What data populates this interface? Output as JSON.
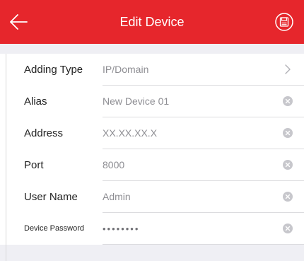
{
  "header": {
    "title": "Edit Device",
    "back_icon": "arrow-left-icon",
    "save_icon": "save-icon"
  },
  "form": {
    "rows": [
      {
        "label": "Adding Type",
        "value": "IP/Domain",
        "action_icon": "chevron-right-icon"
      },
      {
        "label": "Alias",
        "value": "New Device 01",
        "action_icon": "clear-icon"
      },
      {
        "label": "Address",
        "value": "XX.XX.XX.X",
        "action_icon": "clear-icon"
      },
      {
        "label": "Port",
        "value": "8000",
        "action_icon": "clear-icon"
      },
      {
        "label": "User Name",
        "value": "Admin",
        "action_icon": "clear-icon"
      },
      {
        "label": "Device Password",
        "value": "••••••••",
        "action_icon": "clear-icon"
      }
    ]
  },
  "colors": {
    "header_bg": "#e6262c",
    "page_bg": "#efeff4",
    "value_text": "#8e8e93",
    "clear_icon": "#c7c7cc"
  }
}
